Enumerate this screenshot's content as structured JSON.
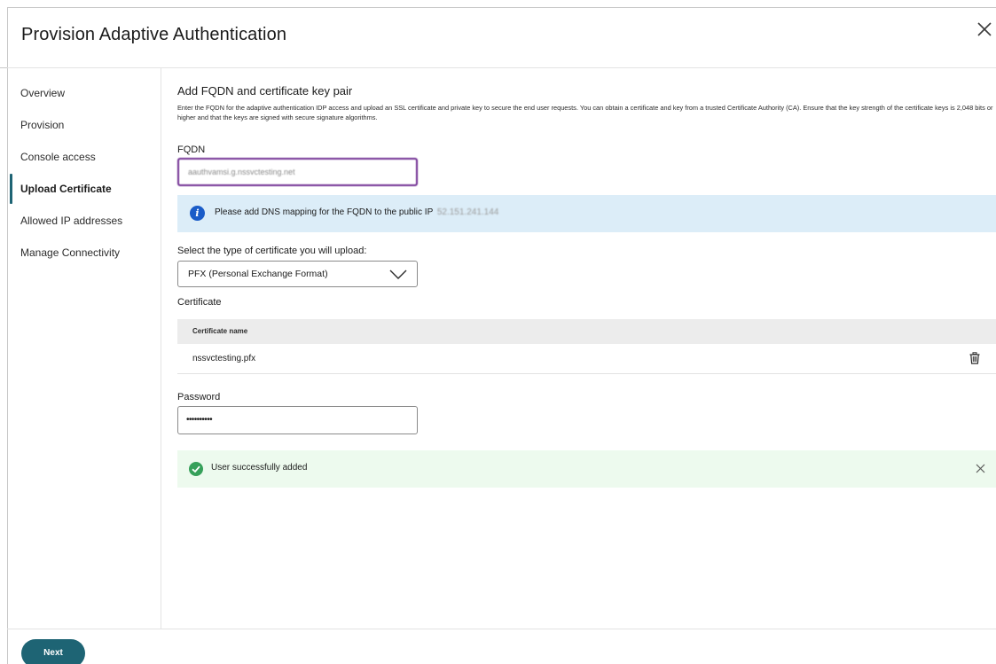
{
  "dialog": {
    "title": "Provision Adaptive Authentication",
    "close_icon": "close-icon"
  },
  "sidebar": {
    "items": [
      {
        "label": "Overview",
        "active": false
      },
      {
        "label": "Provision",
        "active": false
      },
      {
        "label": "Console access",
        "active": false
      },
      {
        "label": "Upload Certificate",
        "active": true
      },
      {
        "label": "Allowed IP addresses",
        "active": false
      },
      {
        "label": "Manage Connectivity",
        "active": false
      }
    ]
  },
  "main": {
    "section_title": "Add FQDN and certificate key pair",
    "description": "Enter the FQDN for the adaptive authentication IDP access and upload an SSL certificate and private key to secure the end user requests. You can obtain a certificate and key from a trusted Certificate Authority (CA). Ensure that the key strength of the certificate keys is 2,048 bits or higher and that the keys are signed with secure signature algorithms.",
    "fqdn_label": "FQDN",
    "fqdn_value": "aauthvamsi.g.nssvctesting.net",
    "info_banner": {
      "icon": "info-icon",
      "text": "Please add DNS mapping for the FQDN to the public IP",
      "ip": "52.151.241.144",
      "color": "#dcedf8"
    },
    "cert_type_label": "Select the type of certificate you will upload:",
    "cert_type_selected": "PFX (Personal Exchange Format)",
    "certificate_label": "Certificate",
    "table": {
      "column_header": "Certificate name",
      "rows": [
        "nssvctesting.pfx"
      ]
    },
    "password_label": "Password",
    "password_value": "••••••••••",
    "success_banner": {
      "icon": "check-circle-icon",
      "text": "User successfully added",
      "color": "#edfaee"
    }
  },
  "footer": {
    "next_label": "Next"
  },
  "colors": {
    "accent": "#1e6474",
    "focus_border": "#6f2c91",
    "info_icon": "#1a5cc8",
    "success_icon": "#36a05a"
  }
}
